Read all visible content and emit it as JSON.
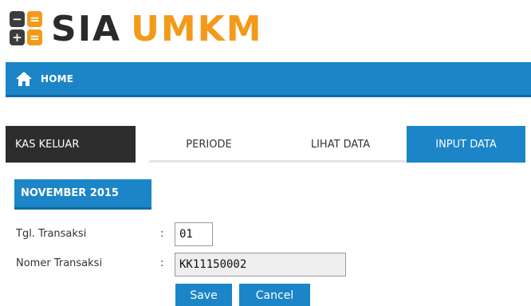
{
  "logo": {
    "icon_glyphs": [
      "−",
      "=",
      "+",
      "="
    ],
    "brand_word1": "SIA",
    "brand_word2": "UMKM"
  },
  "nav": {
    "home_icon": "home-icon",
    "home_label": "HOME"
  },
  "section_title": "KAS KELUAR",
  "tabs": [
    {
      "label": "PERIODE",
      "active": false
    },
    {
      "label": "LIHAT DATA",
      "active": false
    },
    {
      "label": "INPUT DATA",
      "active": true
    }
  ],
  "period_label": "NOVEMBER 2015",
  "form": {
    "tgl_label": "Tgl. Transaksi",
    "tgl_colon": ":",
    "tgl_value": "01",
    "nomer_label": "Nomer Transaksi",
    "nomer_colon": ":",
    "nomer_value": "KK11150002"
  },
  "buttons": {
    "save": "Save",
    "cancel": "Cancel"
  },
  "colors": {
    "primary_blue": "#1b85c7",
    "brand_orange": "#f39a1b",
    "dark": "#2d2d2d"
  }
}
